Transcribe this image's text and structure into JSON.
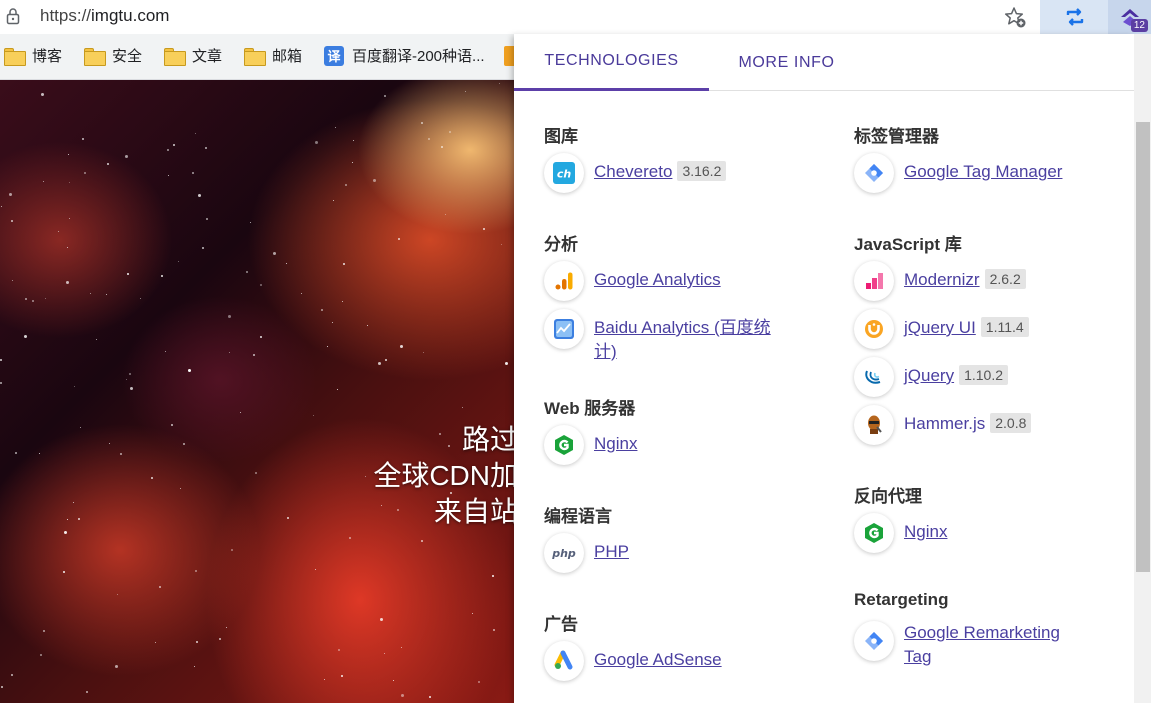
{
  "browser": {
    "url_scheme": "https://",
    "url_host": "imgtu.com",
    "extension_badge": "12"
  },
  "bookmarks": [
    {
      "label": "博客",
      "icon": "folder-icon"
    },
    {
      "label": "安全",
      "icon": "folder-icon"
    },
    {
      "label": "文章",
      "icon": "folder-icon"
    },
    {
      "label": "邮箱",
      "icon": "folder-icon"
    },
    {
      "label": "百度翻译-200种语...",
      "icon": "translate-icon",
      "icon_text": "译"
    }
  ],
  "page": {
    "hero_lines": [
      "路过",
      "全球CDN加",
      "来自站"
    ]
  },
  "popup": {
    "tabs": [
      "TECHNOLOGIES",
      "MORE INFO"
    ],
    "active_tab": "TECHNOLOGIES",
    "left_column": [
      {
        "title": "图库",
        "items": [
          {
            "name": "Chevereto",
            "version": "3.16.2",
            "icon": "chevereto-icon",
            "link": true
          }
        ]
      },
      {
        "title": "分析",
        "items": [
          {
            "name": "Google Analytics",
            "version": "",
            "icon": "google-analytics-icon",
            "link": true
          },
          {
            "name_line1": "Baidu Analytics (百度统",
            "name_line2": "计)",
            "version": "",
            "icon": "baidu-analytics-icon",
            "link": true
          }
        ]
      },
      {
        "title": "Web 服务器",
        "items": [
          {
            "name": "Nginx",
            "version": "",
            "icon": "nginx-icon",
            "link": true
          }
        ]
      },
      {
        "title": "编程语言",
        "items": [
          {
            "name": "PHP",
            "version": "",
            "icon": "php-icon",
            "link": true
          }
        ]
      },
      {
        "title": "广告",
        "items": [
          {
            "name": "Google AdSense",
            "version": "",
            "icon": "adsense-icon",
            "link": true
          }
        ]
      }
    ],
    "right_column": [
      {
        "title": "标签管理器",
        "items": [
          {
            "name": "Google Tag Manager",
            "version": "",
            "icon": "google-tag-manager-icon",
            "link": true
          }
        ]
      },
      {
        "title": "JavaScript 库",
        "items": [
          {
            "name": "Modernizr",
            "version": "2.6.2",
            "icon": "modernizr-icon",
            "link": true
          },
          {
            "name": "jQuery UI",
            "version": "1.11.4",
            "icon": "jquery-ui-icon",
            "link": true
          },
          {
            "name": "jQuery",
            "version": "1.10.2",
            "icon": "jquery-icon",
            "link": true
          },
          {
            "name": "Hammer.js",
            "version": "2.0.8",
            "icon": "hammerjs-icon",
            "link": false
          }
        ]
      },
      {
        "title": "反向代理",
        "items": [
          {
            "name": "Nginx",
            "version": "",
            "icon": "nginx-icon",
            "link": true
          }
        ]
      },
      {
        "title": "Retargeting",
        "items": [
          {
            "name_line1": "Google Remarketing",
            "name_line2": "Tag",
            "version": "",
            "icon": "google-tag-manager-icon",
            "link": true
          }
        ]
      }
    ]
  },
  "colors": {
    "accent": "#5c3fa8",
    "link": "#4a3fa0",
    "version_bg": "#e4e4e4"
  }
}
